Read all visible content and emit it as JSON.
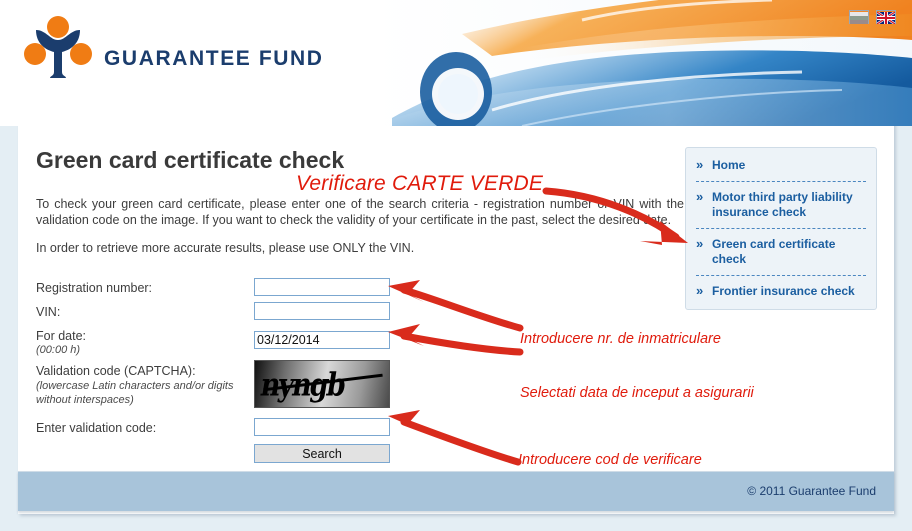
{
  "header": {
    "brand": "GUARANTEE FUND",
    "logo_icon": "guarantee-fund-three-people-logo",
    "flags": [
      {
        "name": "bulgaria-flag",
        "label": "BG"
      },
      {
        "name": "united-kingdom-flag",
        "label": "EN"
      }
    ]
  },
  "main": {
    "title": "Green card certificate check",
    "intro": "To check your green card certificate, please enter one of the search criteria - registration number or VIN with the validation code on the image. If you want to check the validity of your certificate in the past, select the desired date.",
    "intro2": "In order to retrieve more accurate results, please use ONLY the VIN."
  },
  "form": {
    "registration_label": "Registration number:",
    "registration_value": "",
    "vin_label": "VIN:",
    "vin_value": "",
    "date_label": "For date:",
    "date_sub": "(00:00 h)",
    "date_value": "03/12/2014",
    "captcha_label": "Validation code (CAPTCHA):",
    "captcha_sub1": "(lowercase Latin characters and/or digits",
    "captcha_sub2": "without interspaces)",
    "captcha_text": "nyngb",
    "enter_code_label": "Enter validation code:",
    "enter_code_value": "",
    "search_label": "Search"
  },
  "sidebar": {
    "items": [
      {
        "label": "Home",
        "name": "sidebar-item-home"
      },
      {
        "label": "Motor third party liability insurance check",
        "name": "sidebar-item-motor-third-party"
      },
      {
        "label": "Green card certificate check",
        "name": "sidebar-item-green-card"
      },
      {
        "label": "Frontier insurance check",
        "name": "sidebar-item-frontier"
      }
    ],
    "chevron": "»"
  },
  "annotations": {
    "color": "#e01b0c",
    "title": "Verificare CARTE VERDE",
    "a1": "Introducere nr. de inmatriculare",
    "a2": "Selectati data de inceput a asigurarii",
    "a3": "Introducere cod de verificare"
  },
  "footer": {
    "copyright": "© 2011 Guarantee Fund"
  }
}
